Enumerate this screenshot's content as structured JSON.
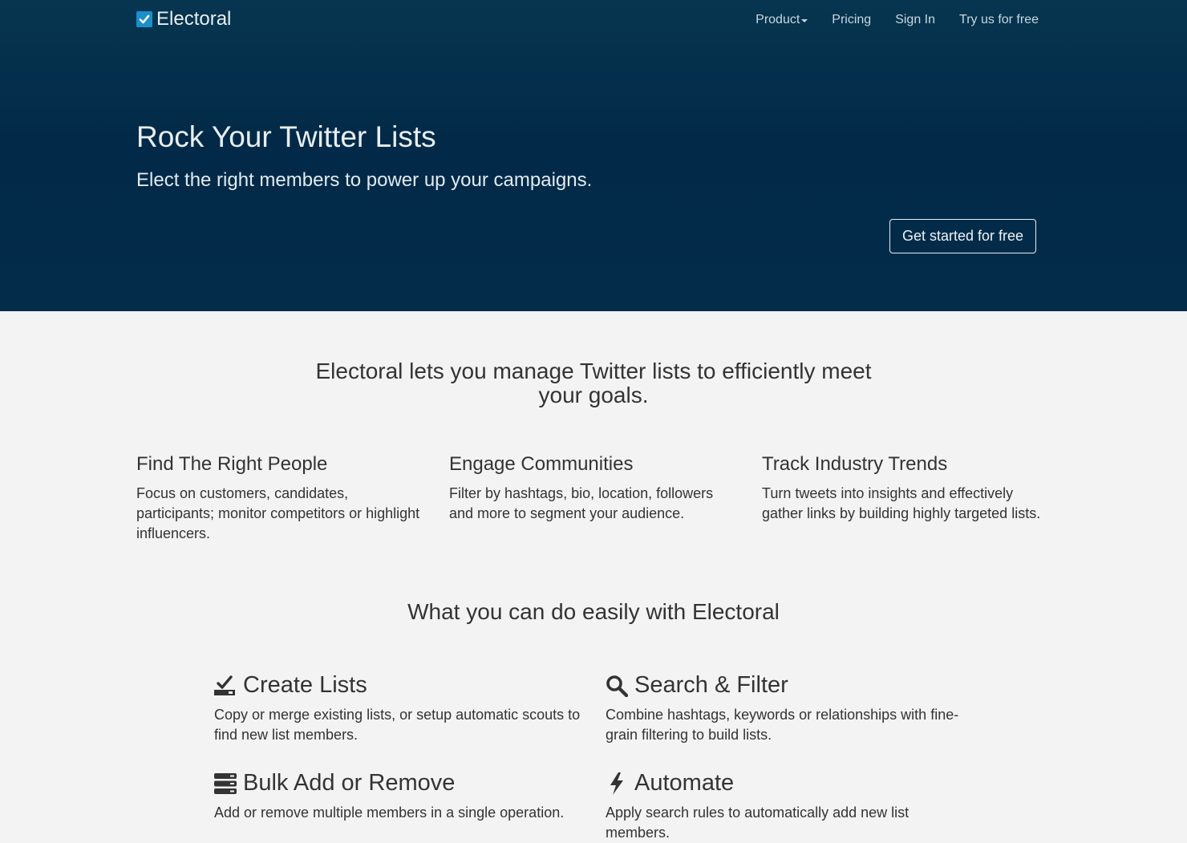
{
  "brand": {
    "name": "Electoral"
  },
  "nav": {
    "product": "Product",
    "pricing": "Pricing",
    "sign_in": "Sign In",
    "try_free": "Try us for free"
  },
  "hero": {
    "title": "Rock Your Twitter Lists",
    "subtitle": "Elect the right members to power up your campaigns.",
    "cta": "Get started for free"
  },
  "intro": "Electoral lets you manage Twitter lists to efficiently meet your goals.",
  "features": [
    {
      "title": "Find The Right People",
      "text": "Focus on customers, candidates, participants; monitor competitors or highlight influencers."
    },
    {
      "title": "Engage Communities",
      "text": "Filter by hashtags, bio, location, followers and more to segment your audience."
    },
    {
      "title": "Track Industry Trends",
      "text": "Turn tweets into insights and effectively gather links by building highly targeted lists."
    }
  ],
  "capabilities_heading": "What you can do easily with Electoral",
  "capabilities": [
    {
      "title": "Create Lists",
      "text": "Copy or merge existing lists, or setup automatic scouts to find new list members.",
      "icon": "check-tray-icon"
    },
    {
      "title": "Search & Filter",
      "text": "Combine hashtags, keywords or relationships with fine-grain filtering to build lists.",
      "icon": "search-icon"
    },
    {
      "title": "Bulk Add or Remove",
      "text": "Add or remove multiple members in a single operation.",
      "icon": "server-stack-icon"
    },
    {
      "title": "Automate",
      "text": "Apply search rules to automatically add new list members.",
      "icon": "bolt-icon"
    }
  ],
  "colors": {
    "hero_bg": "#022a48",
    "brand_check": "#1a8fc9",
    "page_bg": "#f3f3f3"
  }
}
